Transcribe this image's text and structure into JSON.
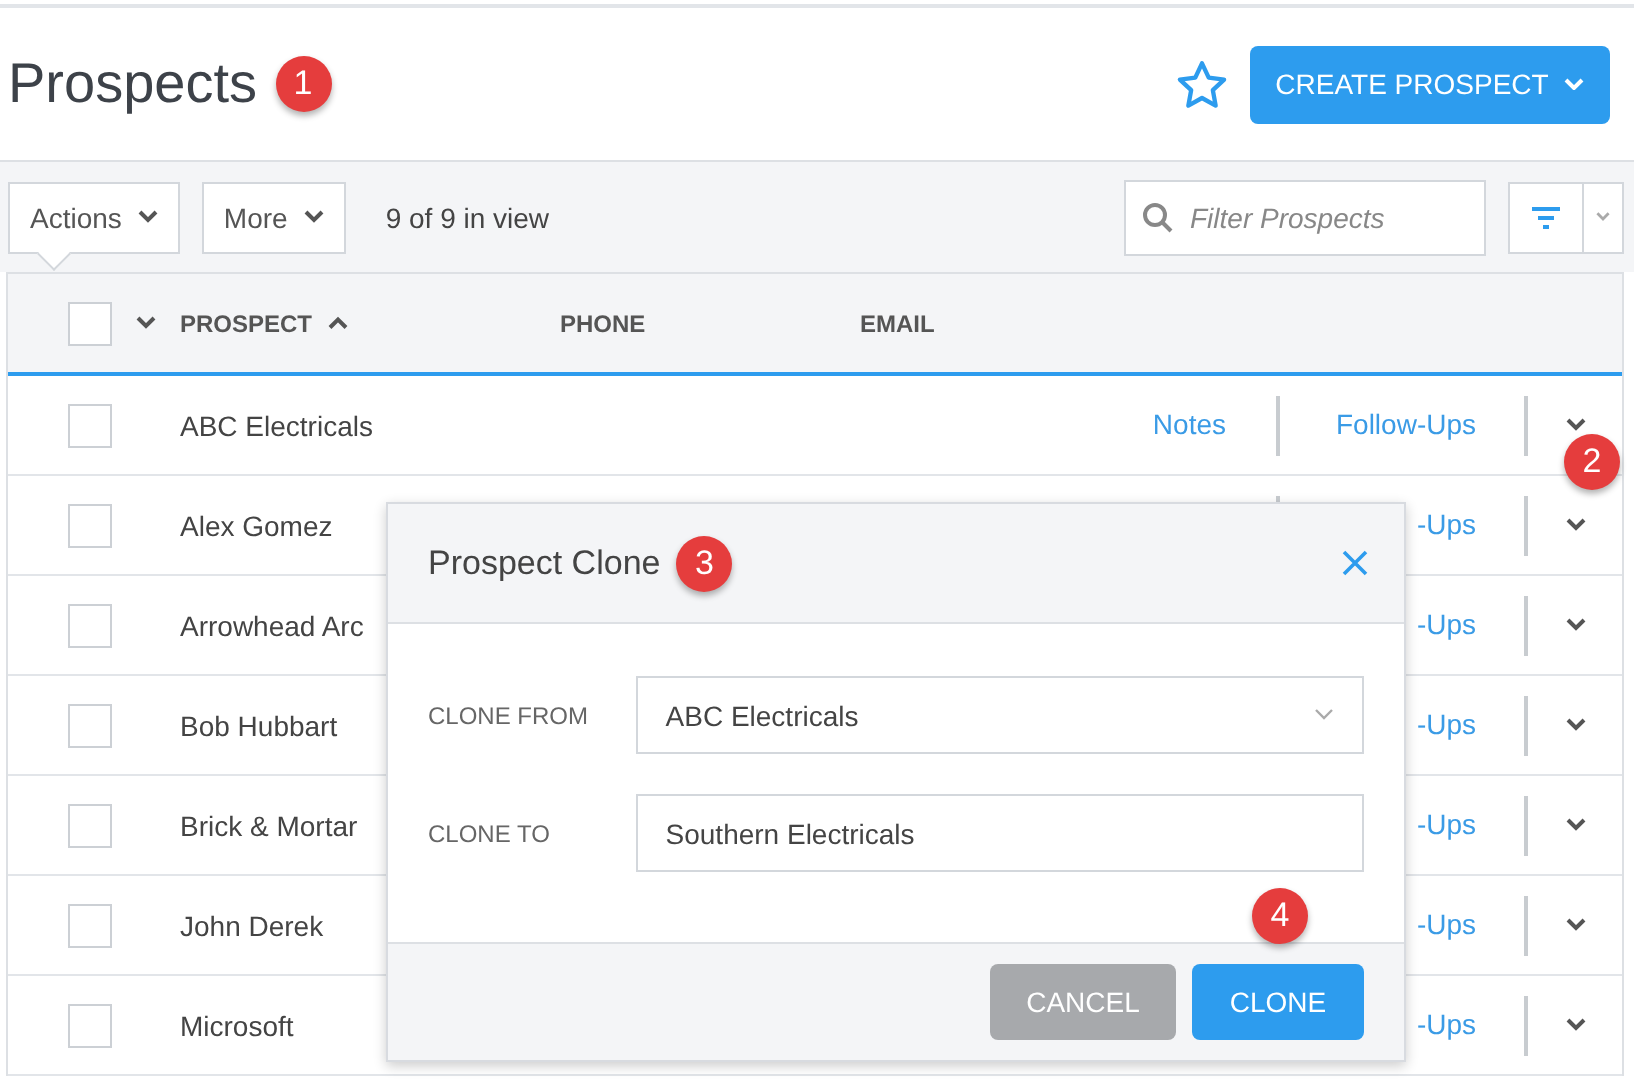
{
  "page": {
    "title": "Prospects",
    "badge": "1",
    "create_button": "CREATE PROSPECT"
  },
  "toolbar": {
    "actions": "Actions",
    "more": "More",
    "count": "9 of 9 in view",
    "filter": {
      "placeholder": "Filter Prospects"
    }
  },
  "table": {
    "select_all_checked": false,
    "columns": [
      {
        "label": "PROSPECT",
        "sorted": true
      },
      {
        "label": "PHONE",
        "sorted": false
      },
      {
        "label": "EMAIL",
        "sorted": false
      }
    ],
    "rows": [
      {
        "name": "ABC Electricals",
        "notes": "Notes",
        "follow_ups": "Follow-Ups",
        "checked": false,
        "badge": "2"
      },
      {
        "name": "Alex Gomez",
        "follow_ups": "-Ups",
        "checked": false
      },
      {
        "name": "Arrowhead Arc",
        "follow_ups": "-Ups",
        "checked": false
      },
      {
        "name": "Bob Hubbart",
        "follow_ups": "-Ups",
        "checked": false
      },
      {
        "name": "Brick & Mortar",
        "follow_ups": "-Ups",
        "checked": false
      },
      {
        "name": "John Derek",
        "follow_ups": "-Ups",
        "checked": false
      },
      {
        "name": "Microsoft",
        "follow_ups": "-Ups",
        "checked": false
      }
    ]
  },
  "dialog": {
    "title": "Prospect Clone",
    "badge": "3",
    "fields": [
      {
        "label": "CLONE FROM",
        "value": "ABC Electricals",
        "kind": "select"
      },
      {
        "label": "CLONE TO",
        "value": "Southern Electricals",
        "kind": "text"
      }
    ],
    "footer_badge": "4",
    "buttons": [
      {
        "label": "CANCEL",
        "kind": "secondary"
      },
      {
        "label": "CLONE",
        "kind": "primary"
      }
    ]
  }
}
